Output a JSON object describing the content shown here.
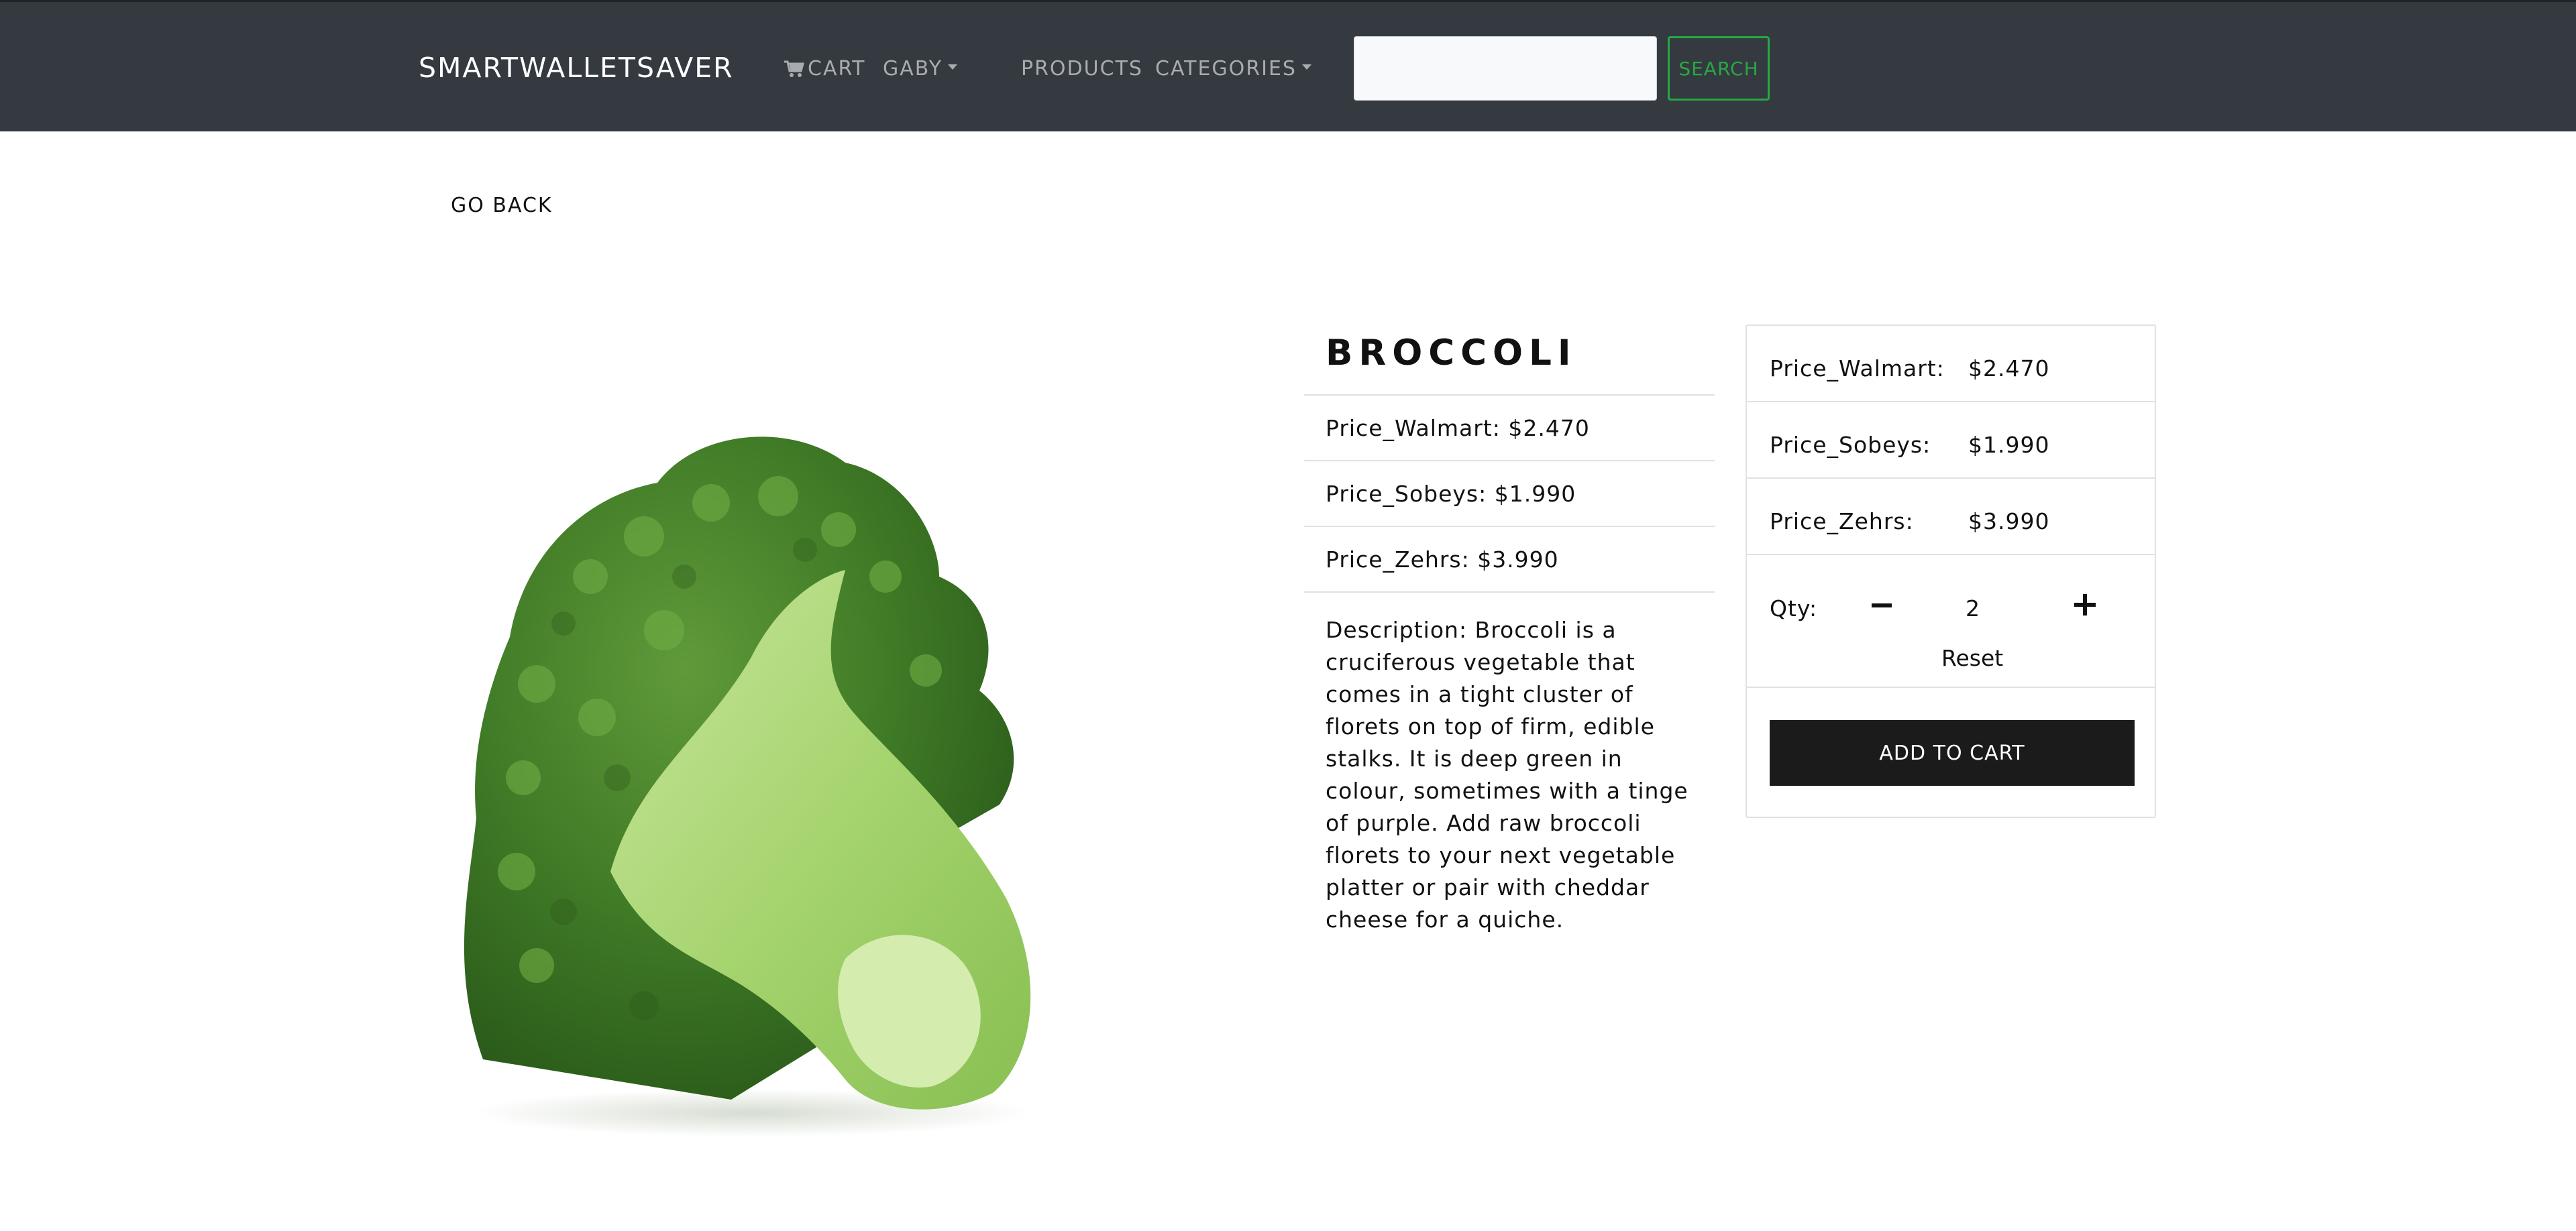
{
  "navbar": {
    "brand": "SMARTWALLETSAVER",
    "cart_label": "CART",
    "user_label": "GABY",
    "products_label": "PRODUCTS",
    "categories_label": "CATEGORIES",
    "search": {
      "value": "",
      "placeholder": ""
    },
    "search_button": "SEARCH"
  },
  "go_back": "GO BACK",
  "product": {
    "name": "BROCCOLI",
    "info_rows": [
      "Price_Walmart: $2.470",
      "Price_Sobeys: $1.990",
      "Price_Zehrs: $3.990"
    ],
    "description": "Description: Broccoli is a cruciferous vegetable that comes in a tight cluster of florets on top of firm, edible stalks. It is deep green in colour, sometimes with a tinge of purple. Add raw broccoli florets to your next vegetable platter or pair with cheddar cheese for a quiche."
  },
  "purchase": {
    "prices": [
      {
        "label": "Price_Walmart:",
        "value": "$2.470"
      },
      {
        "label": "Price_Sobeys:",
        "value": "$1.990"
      },
      {
        "label": "Price_Zehrs:",
        "value": "$3.990"
      }
    ],
    "qty_label": "Qty:",
    "qty_value": "2",
    "reset_label": "Reset",
    "add_to_cart_label": "ADD TO CART"
  },
  "colors": {
    "navbar_bg": "#343a40",
    "search_button_accent": "#28a745",
    "add_to_cart_bg": "#1b1b1b"
  },
  "icons": {
    "cart": "cart-icon",
    "minus": "minus-icon",
    "plus": "plus-icon",
    "dropdown": "chevron-down-icon"
  }
}
